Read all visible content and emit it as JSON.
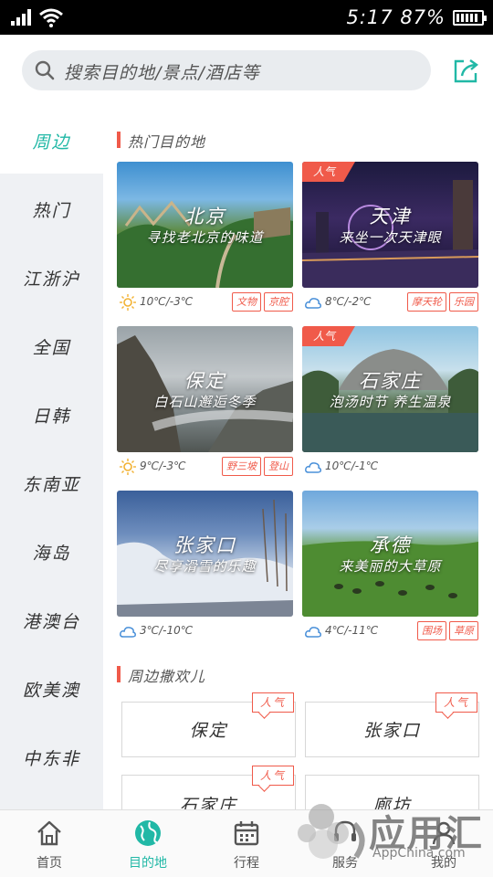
{
  "status_bar": {
    "time": "5:17",
    "battery_percent": "87%",
    "battery_level": 0.87,
    "icons": [
      "signal-icon",
      "wifi-icon",
      "battery-icon"
    ]
  },
  "search": {
    "placeholder": "搜索目的地/景点/酒店等"
  },
  "share": {
    "icon": "share-icon"
  },
  "sidebar": {
    "items": [
      {
        "label": "周边",
        "active": true
      },
      {
        "label": "热门"
      },
      {
        "label": "江浙沪"
      },
      {
        "label": "全国"
      },
      {
        "label": "日韩"
      },
      {
        "label": "东南亚"
      },
      {
        "label": "海岛"
      },
      {
        "label": "港澳台"
      },
      {
        "label": "欧美澳"
      },
      {
        "label": "中东非"
      }
    ]
  },
  "hot_destinations": {
    "title": "热门目的地",
    "cards": [
      {
        "name": "北京",
        "subtitle": "寻找老北京的味道",
        "hot": false,
        "weather": "sunny-icon",
        "temp": "10℃/-3℃",
        "tags": [
          "文物",
          "京腔"
        ]
      },
      {
        "name": "天津",
        "subtitle": "来坐一次天津眼",
        "hot": true,
        "hot_label": "人气",
        "weather": "cloudy-icon",
        "temp": "8℃/-2℃",
        "tags": [
          "摩天轮",
          "乐园"
        ]
      },
      {
        "name": "保定",
        "subtitle": "白石山邂逅冬季",
        "hot": false,
        "weather": "sunny-icon",
        "temp": "9℃/-3℃",
        "tags": [
          "野三坡",
          "登山"
        ]
      },
      {
        "name": "石家庄",
        "subtitle": "泡汤时节 养生温泉",
        "hot": true,
        "hot_label": "人气",
        "weather": "cloudy-icon",
        "temp": "10℃/-1℃",
        "tags": []
      },
      {
        "name": "张家口",
        "subtitle": "尽享滑雪的乐趣",
        "hot": false,
        "weather": "cloudy-icon",
        "temp": "3℃/-10℃",
        "tags": []
      },
      {
        "name": "承德",
        "subtitle": "来美丽的大草原",
        "hot": false,
        "weather": "cloudy-icon",
        "temp": "4℃/-11℃",
        "tags": [
          "围场",
          "草原"
        ]
      }
    ]
  },
  "nearby_fun": {
    "title": "周边撒欢儿",
    "items": [
      {
        "label": "保定",
        "badge": "人气"
      },
      {
        "label": "张家口",
        "badge": "人气"
      },
      {
        "label": "石家庄",
        "badge": "人气"
      },
      {
        "label": "廊坊",
        "badge": ""
      }
    ]
  },
  "bottom_nav": {
    "items": [
      {
        "label": "首页",
        "icon": "home-icon"
      },
      {
        "label": "目的地",
        "icon": "globe-icon",
        "active": true
      },
      {
        "label": "行程",
        "icon": "calendar-icon"
      },
      {
        "label": "服务",
        "icon": "service-icon"
      },
      {
        "label": "我的",
        "icon": "profile-icon"
      }
    ]
  },
  "watermark": {
    "text": "应用汇",
    "sub": "AppChina.com"
  },
  "colors": {
    "accent": "#21b8a6",
    "hot": "#f05a4a",
    "sidebar_bg": "#eff1f4"
  }
}
